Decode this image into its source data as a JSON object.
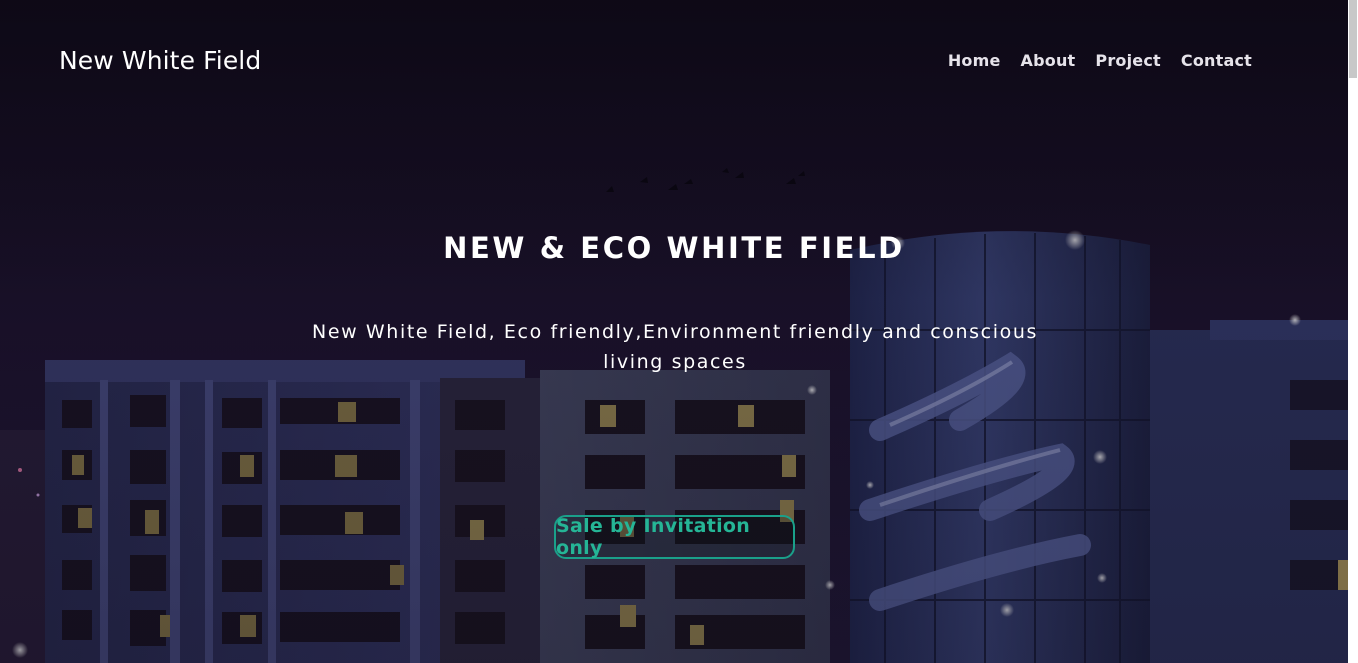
{
  "navbar": {
    "brand": "New White Field",
    "links": [
      "Home",
      "About",
      "Project",
      "Contact"
    ]
  },
  "hero": {
    "headline": "NEW & ECO WHITE FIELD",
    "subline": "New White Field, Eco friendly,Environment friendly and conscious living spaces",
    "cta_label": "Sale by Invitation only"
  },
  "colors": {
    "accent": "#1aa08a",
    "background": "#14101f",
    "text": "#ffffff"
  }
}
